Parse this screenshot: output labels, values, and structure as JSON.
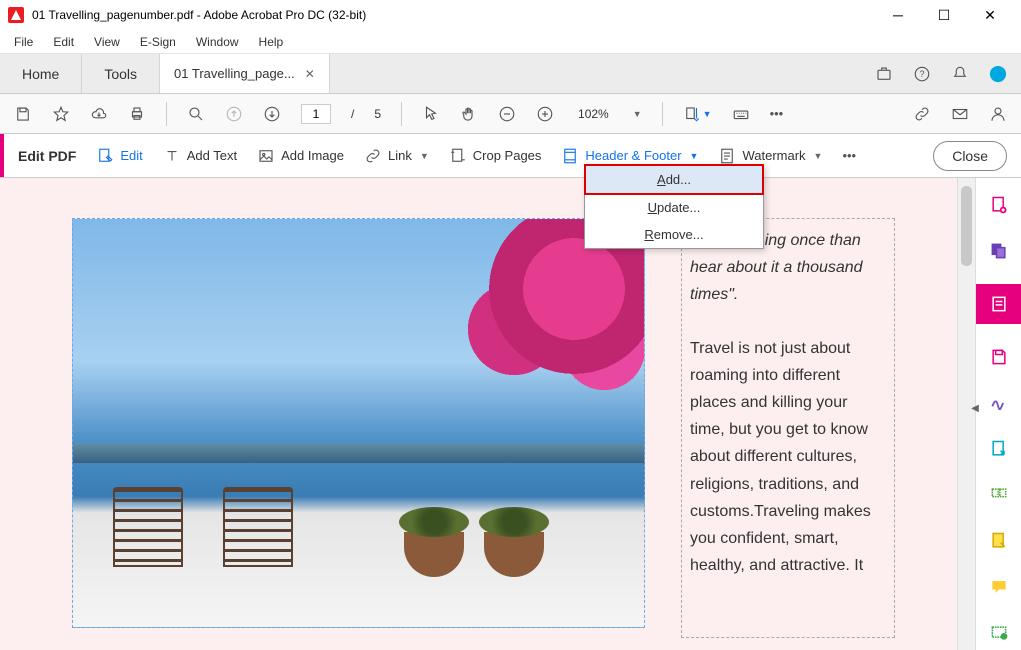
{
  "titlebar": {
    "title": "01 Travelling_pagenumber.pdf - Adobe Acrobat Pro DC (32-bit)"
  },
  "menubar": [
    "File",
    "Edit",
    "View",
    "E-Sign",
    "Window",
    "Help"
  ],
  "tabrow": {
    "home": "Home",
    "tools": "Tools",
    "doc_tab": "01 Travelling_page..."
  },
  "toolbar": {
    "page_current": "1",
    "page_sep": "/",
    "page_total": "5",
    "zoom_value": "102%"
  },
  "editbar": {
    "title": "Edit PDF",
    "edit": "Edit",
    "add_text": "Add Text",
    "add_image": "Add Image",
    "link": "Link",
    "crop": "Crop Pages",
    "header_footer": "Header & Footer",
    "watermark": "Watermark",
    "close": "Close"
  },
  "dropdown": {
    "add": "Add...",
    "update": "Update...",
    "remove": "Remove..."
  },
  "document": {
    "quote_visible": "ee something once than hear about it a thousand times\".",
    "body": "Travel is not just about roaming into different places and killing your time, but you get to know about different cultures, religions, traditions, and customs.Traveling makes you confident, smart, healthy, and attractive. It"
  }
}
